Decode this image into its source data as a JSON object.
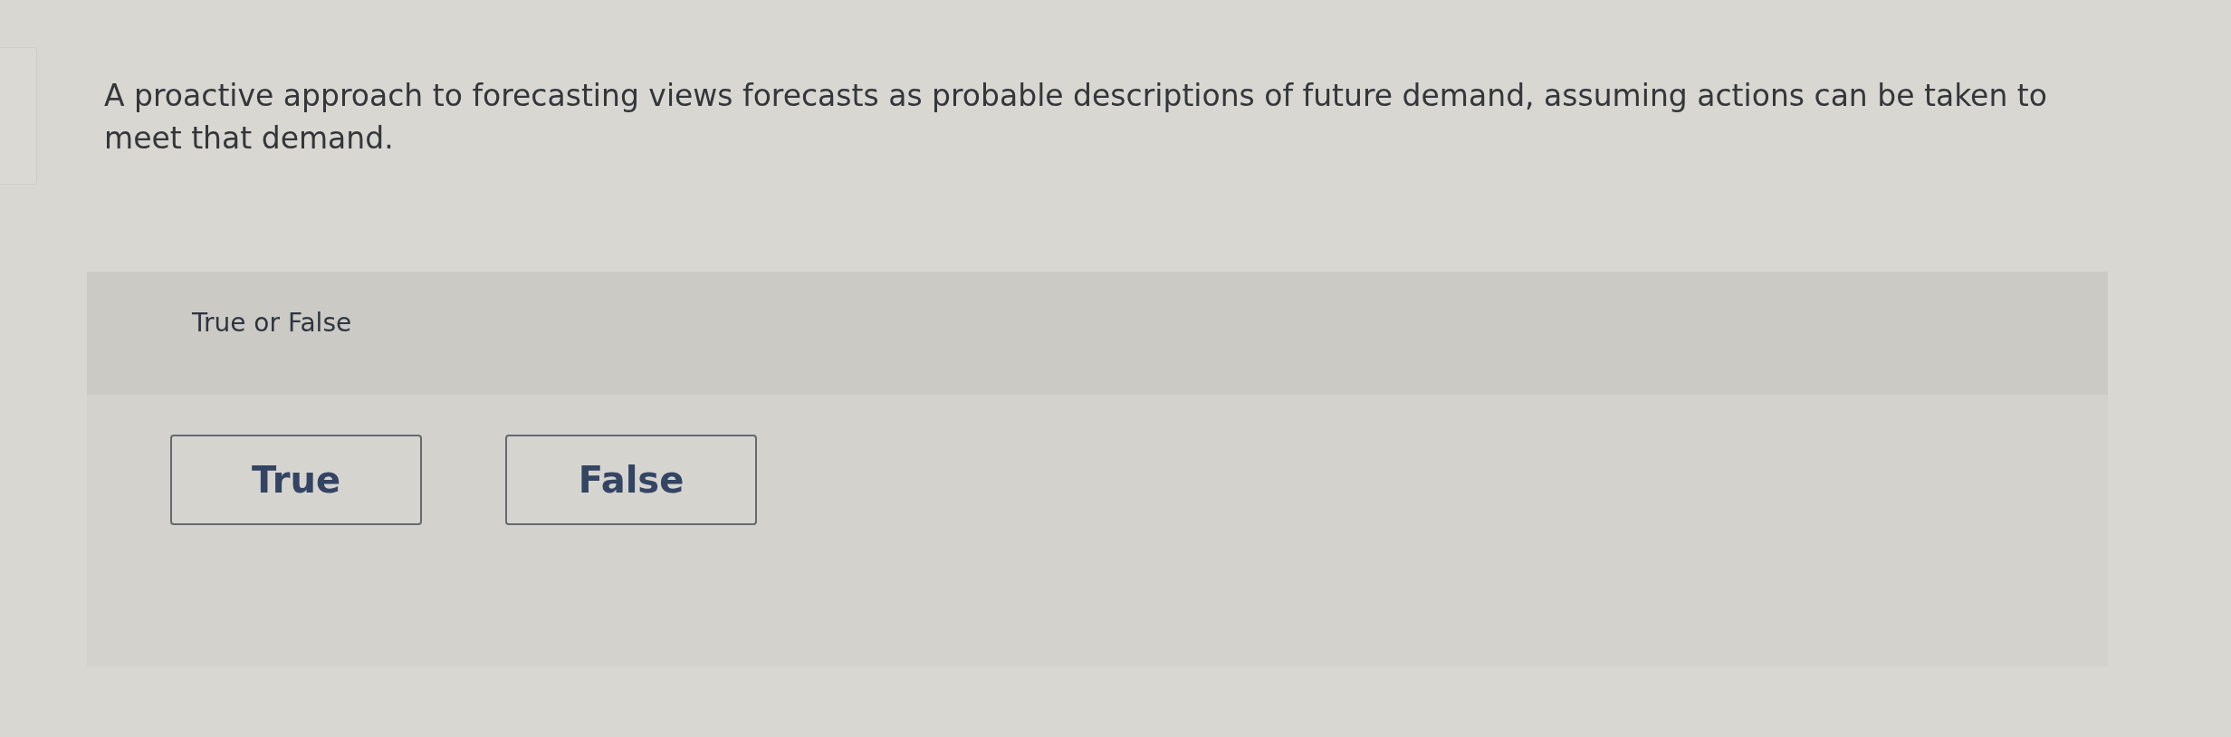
{
  "question": {
    "text": "A proactive approach to forecasting views forecasts as probable descriptions of future demand, assuming actions can be taken to meet that demand."
  },
  "answer_panel": {
    "prompt": "True or False",
    "options": [
      {
        "label": "True"
      },
      {
        "label": "False"
      }
    ]
  }
}
